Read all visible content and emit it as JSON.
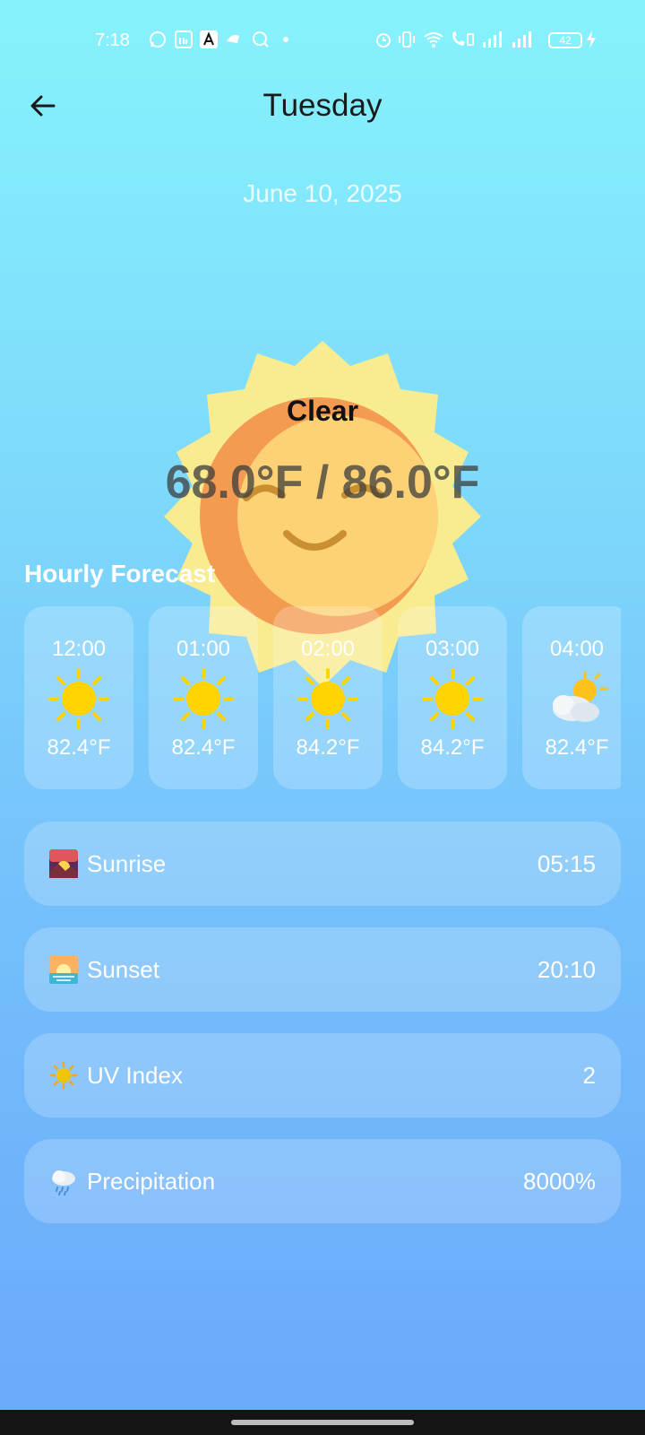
{
  "status_bar": {
    "time": "7:18",
    "battery": "42",
    "icons_left": [
      "whatsapp-icon",
      "linkedin-icon",
      "app-a-icon",
      "app-icon",
      "search-circle-icon",
      "dot-icon"
    ],
    "icons_right": [
      "alarm-icon",
      "vibrate-icon",
      "wifi-icon",
      "call-wifi-icon",
      "signal-icon",
      "signal-icon"
    ]
  },
  "header": {
    "title": "Tuesday",
    "date": "June 10, 2025"
  },
  "current": {
    "condition": "Clear",
    "temp_range": "68.0°F / 86.0°F"
  },
  "hourly": {
    "title": "Hourly Forecast",
    "items": [
      {
        "time": "12:00",
        "temp": "82.4°F",
        "icon": "sun-icon"
      },
      {
        "time": "01:00",
        "temp": "82.4°F",
        "icon": "sun-icon"
      },
      {
        "time": "02:00",
        "temp": "84.2°F",
        "icon": "sun-icon"
      },
      {
        "time": "03:00",
        "temp": "84.2°F",
        "icon": "sun-icon"
      },
      {
        "time": "04:00",
        "temp": "82.4°F",
        "icon": "partly-cloudy-icon"
      }
    ]
  },
  "details": [
    {
      "label": "Sunrise",
      "value": "05:15",
      "icon": "sunrise-icon"
    },
    {
      "label": "Sunset",
      "value": "20:10",
      "icon": "sunset-icon"
    },
    {
      "label": "UV Index",
      "value": "2",
      "icon": "sun-small-icon"
    },
    {
      "label": "Precipitation",
      "value": "8000%",
      "icon": "rain-cloud-icon"
    }
  ],
  "colors": {
    "sun_yellow": "#ffd400",
    "sun_glow": "#ffec8a",
    "face": "#fdd276",
    "face_shadow": "#f2924a"
  }
}
